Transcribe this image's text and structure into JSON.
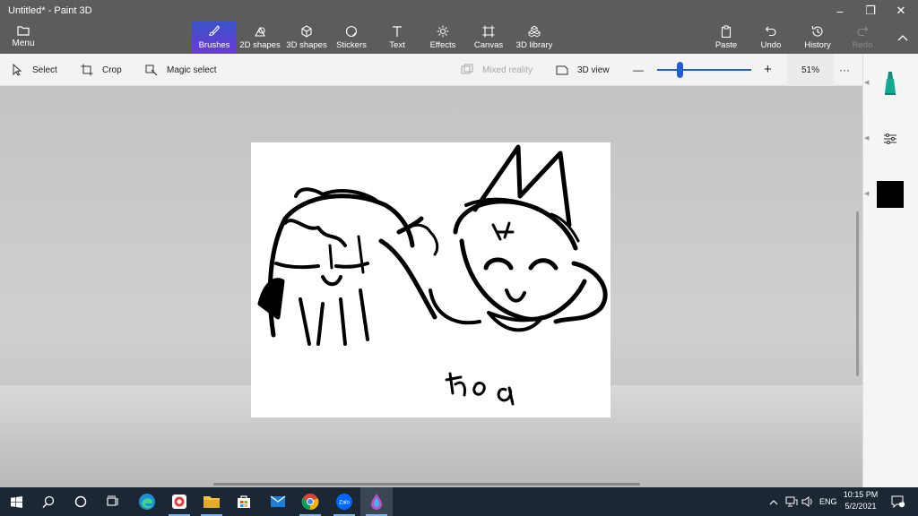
{
  "window": {
    "title": "Untitled* - Paint 3D",
    "controls": {
      "minimize": "–",
      "maximize": "❐",
      "close": "✕"
    }
  },
  "ribbon": {
    "menu_label": "Menu",
    "tools": [
      {
        "label": "Brushes",
        "icon": "brush-icon",
        "active": true
      },
      {
        "label": "2D shapes",
        "icon": "2d-shapes-icon"
      },
      {
        "label": "3D shapes",
        "icon": "3d-shapes-icon"
      },
      {
        "label": "Stickers",
        "icon": "stickers-icon"
      },
      {
        "label": "Text",
        "icon": "text-icon"
      },
      {
        "label": "Effects",
        "icon": "effects-icon"
      },
      {
        "label": "Canvas",
        "icon": "canvas-icon"
      },
      {
        "label": "3D library",
        "icon": "3d-library-icon"
      }
    ],
    "right_actions": [
      {
        "label": "Paste",
        "icon": "paste-icon"
      },
      {
        "label": "Undo",
        "icon": "undo-icon"
      },
      {
        "label": "History",
        "icon": "history-icon"
      },
      {
        "label": "Redo",
        "icon": "redo-icon",
        "disabled": true
      }
    ],
    "accent_color": "#4a46d4"
  },
  "toolbar": {
    "select_label": "Select",
    "crop_label": "Crop",
    "magic_select_label": "Magic select",
    "mixed_reality_label": "Mixed reality",
    "view_3d_label": "3D view",
    "zoom_minus": "—",
    "zoom_plus": "+",
    "zoom_percent": "51%",
    "more": "···",
    "zoom_level": 0.51
  },
  "canvas": {
    "drawing_text": "hoa",
    "background": "#ffffff",
    "stroke_color": "#000000"
  },
  "right_panel": {
    "tool": "marker-icon",
    "settings": "adjustments-icon",
    "color_swatch": "#000000"
  },
  "taskbar": {
    "apps": [
      "windows-start-icon",
      "search-icon",
      "cortana-icon",
      "task-view-icon",
      "edge-icon",
      "chrome-alt-icon",
      "file-explorer-icon",
      "store-icon",
      "mail-icon",
      "chrome-icon",
      "zalo-icon",
      "paint-3d-icon"
    ],
    "zalo_label": "Zalo",
    "language": "ENG",
    "time": "10:15 PM",
    "date": "5/2/2021",
    "notification_count": "1"
  }
}
